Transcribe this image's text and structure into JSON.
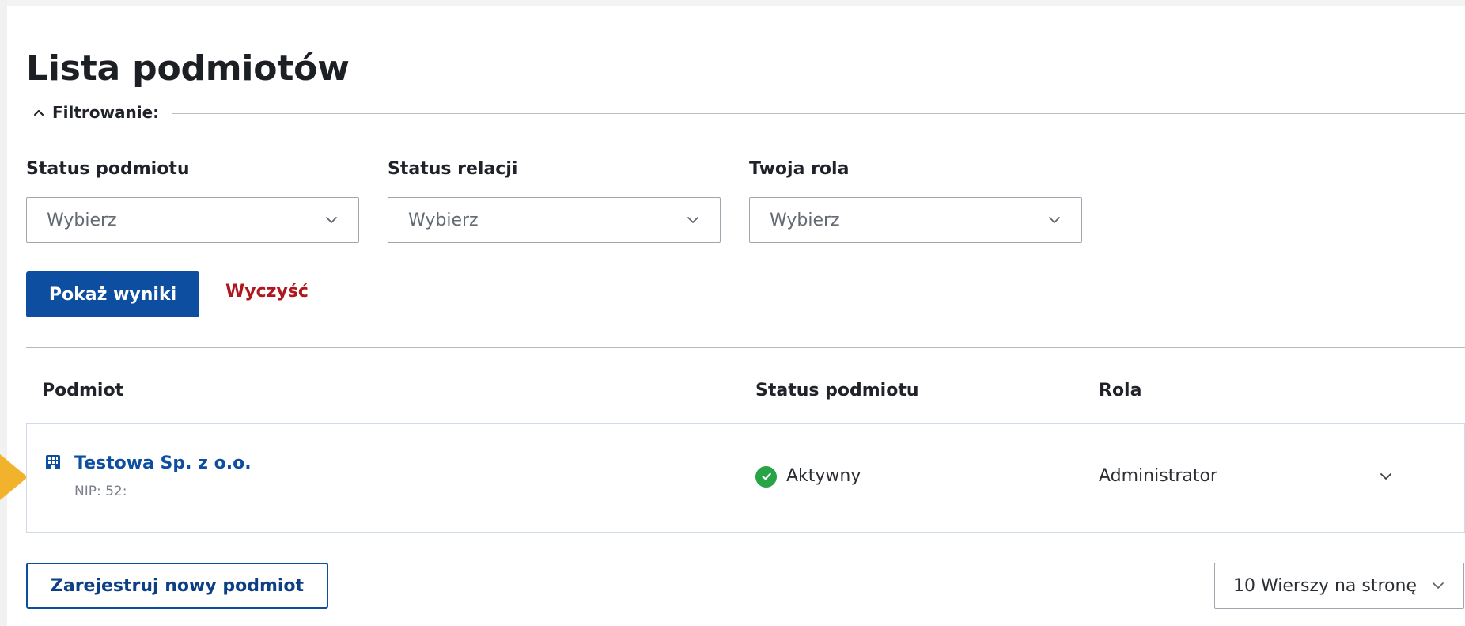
{
  "page": {
    "title": "Lista podmiotów"
  },
  "filters": {
    "section_label": "Filtrowanie:",
    "fields": [
      {
        "label": "Status podmiotu",
        "value": "Wybierz"
      },
      {
        "label": "Status relacji",
        "value": "Wybierz"
      },
      {
        "label": "Twoja rola",
        "value": "Wybierz"
      }
    ],
    "show_results_label": "Pokaż wyniki",
    "clear_label": "Wyczyść"
  },
  "table": {
    "columns": [
      "Podmiot",
      "Status podmiotu",
      "Rola"
    ],
    "rows": [
      {
        "name": "Testowa Sp. z o.o.",
        "nip": "NIP: 52:",
        "status": "Aktywny",
        "role": "Administrator"
      }
    ]
  },
  "footer": {
    "register_label": "Zarejestruj nowy podmiot",
    "page_size_label": "10 Wierszy na stronę"
  },
  "icons": {
    "filter_toggle": "chevron-up-icon",
    "select_chevron": "chevron-down-icon",
    "entity": "building-icon",
    "status": "check-circle-icon",
    "row_expand": "chevron-down-icon",
    "row_pointer": "arrow-icon"
  },
  "colors": {
    "primary": "#0e4ea0",
    "danger": "#b0161d",
    "success": "#28a346",
    "pointer": "#f1b32b"
  }
}
